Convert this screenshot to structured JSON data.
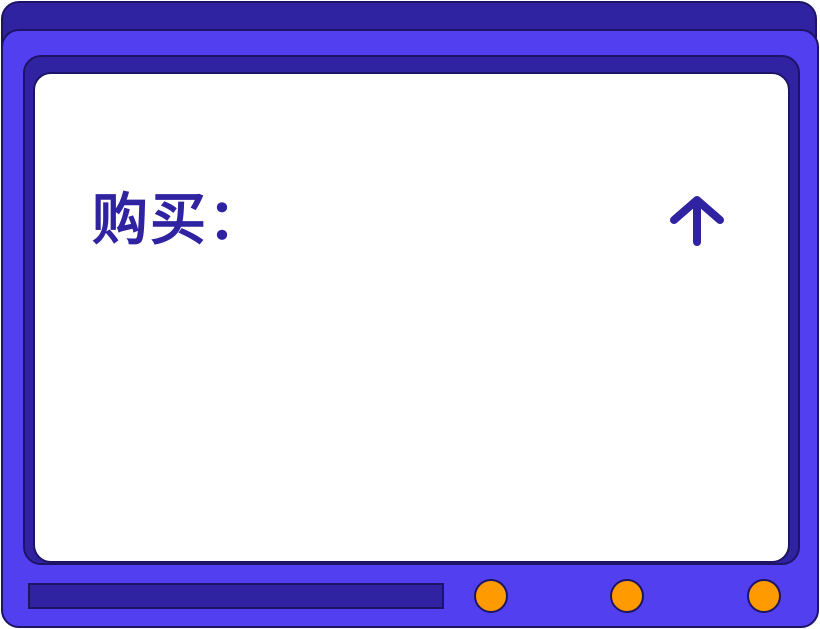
{
  "screen": {
    "label": "购买：",
    "arrow_icon": "arrow-up-icon"
  },
  "colors": {
    "frame": "#523ff0",
    "bezel": "#3023a1",
    "outline": "#1e1466",
    "screen": "#ffffff",
    "knob": "#ff9a00"
  }
}
